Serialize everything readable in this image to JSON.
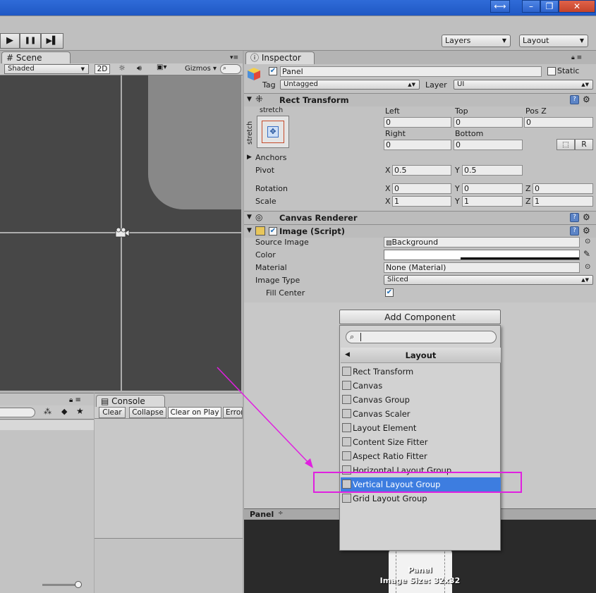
{
  "toolbar": {
    "play_label": "▶",
    "pause_label": "❚❚",
    "step_label": "▶▌",
    "layers_label": "Layers",
    "layout_label": "Layout"
  },
  "scene": {
    "tab_label": "Scene",
    "shaded_label": "Shaded",
    "mode_2d": "2D",
    "gizmos_label": "Gizmos"
  },
  "inspector": {
    "tab_label": "Inspector",
    "object_name": "Panel",
    "static_label": "Static",
    "tag_label": "Tag",
    "tag_value": "Untagged",
    "layer_label": "Layer",
    "layer_value": "UI",
    "rect": {
      "title": "Rect Transform",
      "anchor_label": "stretch",
      "left_label": "Left",
      "left_value": "0",
      "top_label": "Top",
      "top_value": "0",
      "posz_label": "Pos Z",
      "posz_value": "0",
      "right_label": "Right",
      "right_value": "0",
      "bottom_label": "Bottom",
      "bottom_value": "0",
      "r_label": "R",
      "anchors_label": "Anchors",
      "pivot_label": "Pivot",
      "pivot_x": "0.5",
      "pivot_y": "0.5",
      "rotation_label": "Rotation",
      "rot_x": "0",
      "rot_y": "0",
      "rot_z": "0",
      "scale_label": "Scale",
      "scale_x": "1",
      "scale_y": "1",
      "scale_z": "1",
      "x": "X",
      "y": "Y",
      "z": "Z"
    },
    "canvas_renderer_title": "Canvas Renderer",
    "image": {
      "title": "Image (Script)",
      "source_label": "Source Image",
      "source_value": "Background",
      "color_label": "Color",
      "material_label": "Material",
      "material_value": "None (Material)",
      "type_label": "Image Type",
      "type_value": "Sliced",
      "fill_label": "Fill Center"
    },
    "add_component_label": "Add Component"
  },
  "popup": {
    "title": "Layout",
    "items": [
      {
        "label": "Rect Transform"
      },
      {
        "label": "Canvas"
      },
      {
        "label": "Canvas Group"
      },
      {
        "label": "Canvas Scaler"
      },
      {
        "label": "Layout Element"
      },
      {
        "label": "Content Size Fitter"
      },
      {
        "label": "Aspect Ratio Fitter"
      },
      {
        "label": "Horizontal Layout Group"
      },
      {
        "label": "Vertical Layout Group"
      },
      {
        "label": "Grid Layout Group"
      }
    ],
    "selected_index": 8
  },
  "console": {
    "tab_label": "Console",
    "clear_label": "Clear",
    "collapse_label": "Collapse",
    "clear_on_play_label": "Clear on Play",
    "error_label": "Error"
  },
  "preview": {
    "header_label": "Panel",
    "name_label": "Panel",
    "size_label": "Image Size: 32x32"
  },
  "colors": {
    "selection": "#3d7de0",
    "highlight_box": "#e020e0",
    "title_bar": "#2a66d4"
  }
}
